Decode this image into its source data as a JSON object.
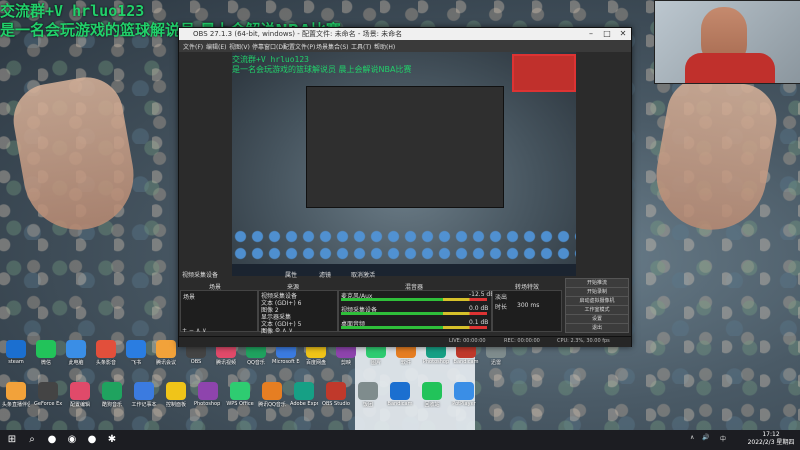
{
  "overlay": {
    "line1": "交流群+V hrluo123",
    "line2": "是一名会玩游戏的篮球解说员 晨上会解说NBA比赛"
  },
  "obs": {
    "title": "OBS 27.1.3 (64-bit, windows) - 配置文件: 未命名 - 场景: 未命名",
    "menu": [
      "文件(F)",
      "编辑(E)",
      "视图(V)",
      "停靠窗口(D)",
      "配置文件(P)",
      "场景集合(S)",
      "工具(T)",
      "帮助(H)"
    ],
    "preview_overlay": {
      "line1": "交流群+V hrluo123",
      "line2": "是一名会玩游戏的篮球解说员 晨上会解说NBA比赛"
    },
    "source_toolbar": {
      "no_source_selected": "视频采集设备",
      "properties": "属性",
      "filters": "滤镜",
      "deactivate": "取消激活"
    },
    "docks": {
      "scenes": {
        "title": "场景",
        "items": [
          "场景"
        ]
      },
      "sources": {
        "title": "来源",
        "items": [
          "视频采集设备",
          "文本 (GDI+) 6",
          "图像 2",
          "显示器采集",
          "文本 (GDI+) 5",
          "图像"
        ]
      },
      "mixer": {
        "title": "混音器",
        "channels": [
          {
            "name": "麦克风/Aux",
            "level": "-12.5 dB"
          },
          {
            "name": "视频采集设备",
            "level": "0.0 dB"
          },
          {
            "name": "桌面音频",
            "level": "0.1 dB"
          }
        ]
      },
      "transitions": {
        "title": "转场特效",
        "type": "淡出",
        "duration_label": "时长",
        "duration": "300 ms"
      },
      "controls": {
        "title": "控件",
        "buttons": [
          "开始推流",
          "开始录制",
          "启动虚拟摄像机",
          "工作室模式",
          "设置",
          "退出"
        ]
      }
    },
    "status": {
      "live": "LIVE: 00:00:00",
      "rec": "REC: 00:00:00",
      "cpu": "CPU: 2.3%, 30.00 fps"
    }
  },
  "desktop_icons": {
    "row1": [
      "steam",
      "微信",
      "此电脑",
      "头条影音",
      "飞书",
      "腾讯会议",
      "OBS",
      "腾讯视频",
      "QQ音乐",
      "Microsoft Edge",
      "百度网盘",
      "剪映",
      "图片",
      "软件",
      "Photoshop",
      "Bandicam",
      "迅雷"
    ],
    "row2": [
      "头条直播伴侣",
      "GeForce Experience",
      "配置编辑",
      "酷狗音乐",
      "工作记事本",
      "控制面板",
      "Photoshop 2021",
      "WPS Office",
      "腾讯QQ音乐",
      "Adobe Express",
      "OBS Studio",
      "饭团",
      "Bandicam",
      "回收站",
      "PotPlayer"
    ]
  },
  "taskbar": {
    "clock_time": "17:12",
    "clock_date": "2022/2/3 星期四",
    "ime": "中"
  }
}
